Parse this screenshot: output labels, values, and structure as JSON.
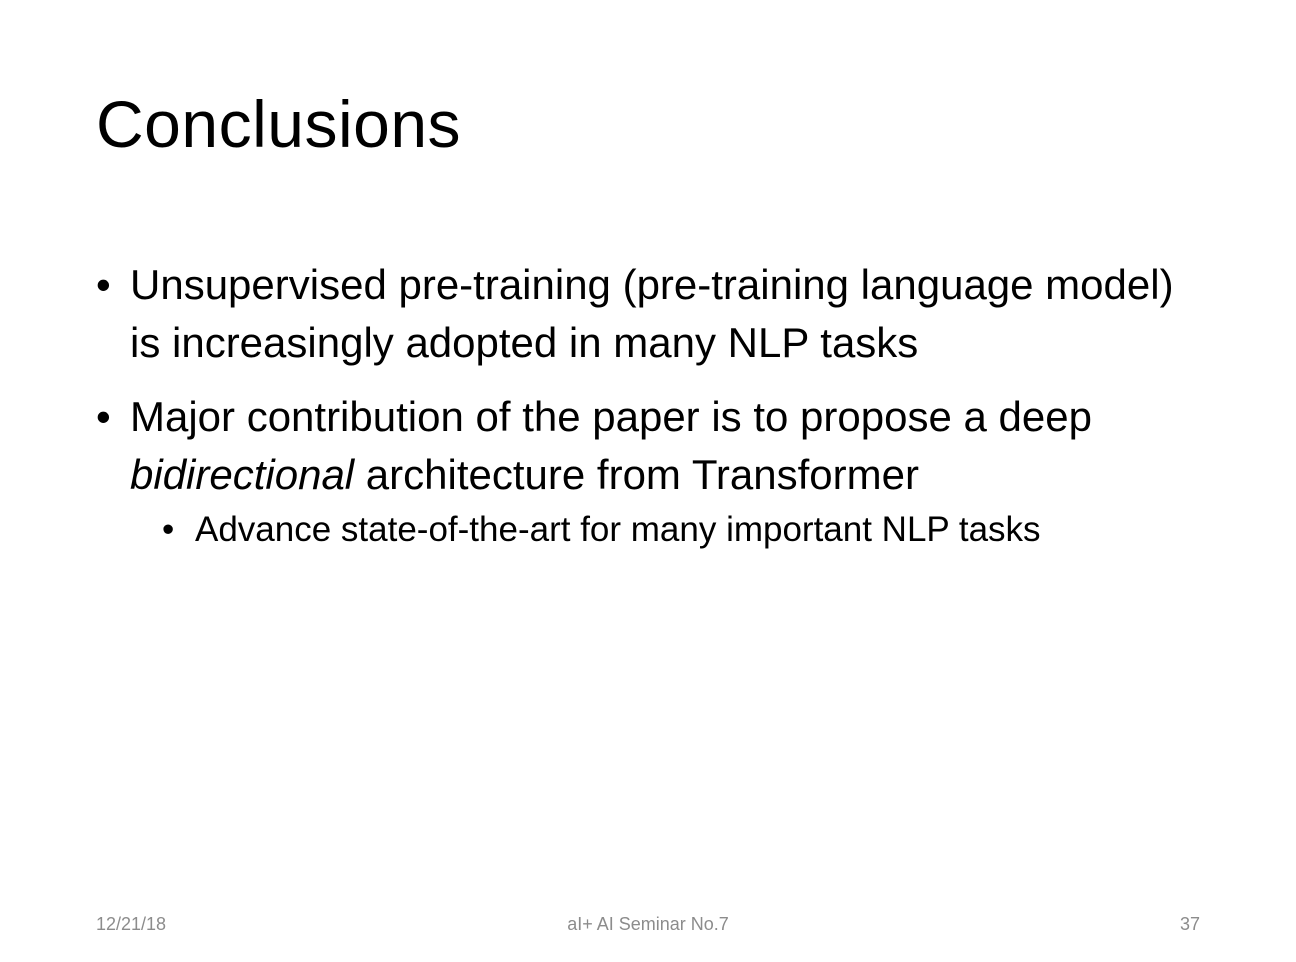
{
  "slide": {
    "title": "Conclusions",
    "bullets": [
      {
        "symbol": "•",
        "text": "Unsupervised pre-training (pre-training language model) is increasingly adopted in many NLP tasks"
      },
      {
        "symbol": "•",
        "text_before": "Major contribution of the paper is to propose a deep ",
        "text_italic": "bidirectional",
        "text_after": " architecture from Transformer",
        "sub_bullets": [
          {
            "symbol": "•",
            "text": "Advance state-of-the-art for many important NLP tasks"
          }
        ]
      }
    ]
  },
  "footer": {
    "date": "12/21/18",
    "center": "aI+ AI Seminar No.7",
    "page_number": "37"
  },
  "colors": {
    "background": "#ffffff",
    "text": "#000000",
    "footer_text": "#8c8c8c"
  }
}
